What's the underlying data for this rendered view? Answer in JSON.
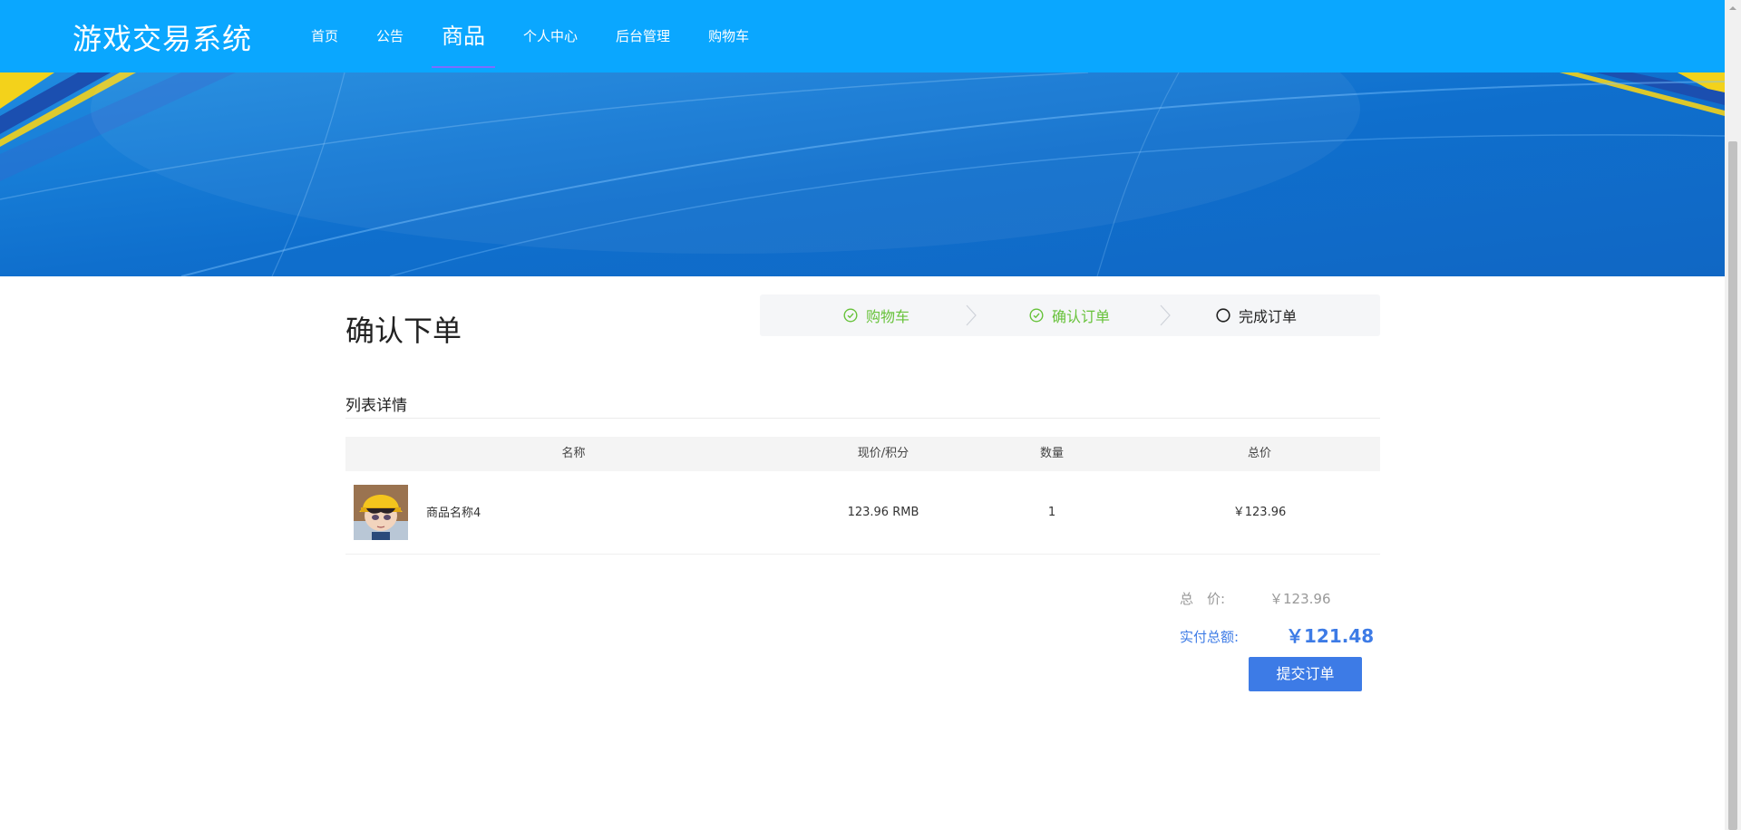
{
  "header": {
    "logo": "游戏交易系统",
    "nav": [
      "首页",
      "公告",
      "商品",
      "个人中心",
      "后台管理",
      "购物车"
    ],
    "active_index": 2
  },
  "page": {
    "title": "确认下单",
    "steps": [
      {
        "label": "购物车",
        "status": "done"
      },
      {
        "label": "确认订单",
        "status": "done"
      },
      {
        "label": "完成订单",
        "status": "current"
      }
    ],
    "section_title": "列表详情"
  },
  "table": {
    "columns": [
      "名称",
      "现价/积分",
      "数量",
      "总价"
    ],
    "rows": [
      {
        "name": "商品名称4",
        "price": "123.96 RMB",
        "qty": "1",
        "total": "￥123.96"
      }
    ]
  },
  "summary": {
    "total_label": "总　价:",
    "total_value": "￥123.96",
    "paid_label": "实付总额:",
    "paid_value": "￥121.48",
    "submit_label": "提交订单"
  },
  "colors": {
    "header": "#0aa7ff",
    "success": "#67c23a",
    "accent": "#3d7be6"
  }
}
